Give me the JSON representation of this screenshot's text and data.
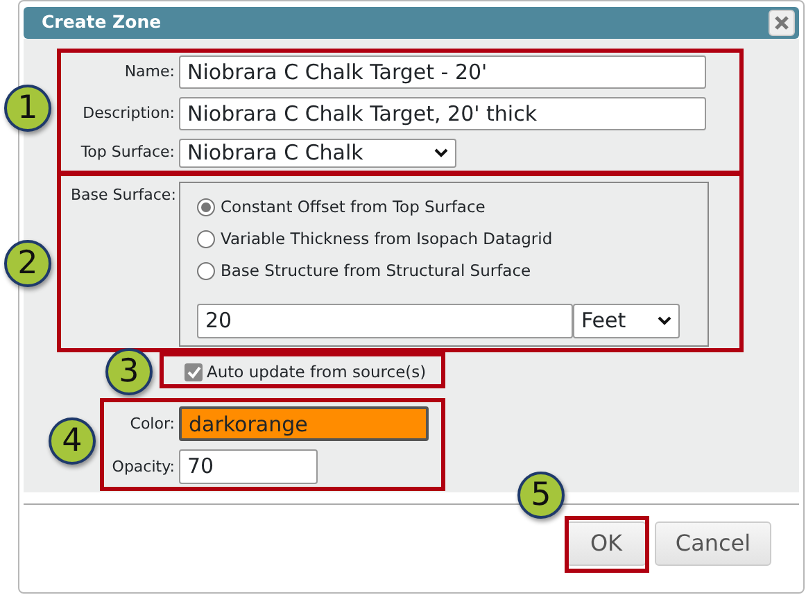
{
  "dialog": {
    "title": "Create Zone"
  },
  "fields": [
    {
      "label": "Name:",
      "value": "Niobrara C Chalk Target - 20'",
      "kind": "text"
    },
    {
      "label": "Description:",
      "value": "Niobrara C Chalk Target, 20' thick",
      "kind": "text"
    },
    {
      "label": "Top Surface:",
      "value": "Niobrara C Chalk",
      "kind": "select"
    }
  ],
  "base_surface": {
    "label": "Base Surface:",
    "options": [
      {
        "label": "Constant Offset from Top Surface",
        "selected": true
      },
      {
        "label": "Variable Thickness from Isopach Datagrid",
        "selected": false
      },
      {
        "label": "Base Structure from Structural Surface",
        "selected": false
      }
    ],
    "offset": {
      "value": "20"
    },
    "unit": {
      "value": "Feet"
    }
  },
  "auto_update": {
    "label": "Auto update from source(s)",
    "checked": true
  },
  "color": {
    "label": "Color:",
    "value": "darkorange",
    "color": "#ff8c00"
  },
  "opacity": {
    "label": "Opacity:",
    "value": "70"
  },
  "buttons": [
    {
      "label": "OK"
    },
    {
      "label": "Cancel"
    }
  ],
  "callouts": [
    {
      "number": "1"
    },
    {
      "number": "2"
    },
    {
      "number": "3"
    },
    {
      "number": "4"
    },
    {
      "number": "5"
    }
  ]
}
